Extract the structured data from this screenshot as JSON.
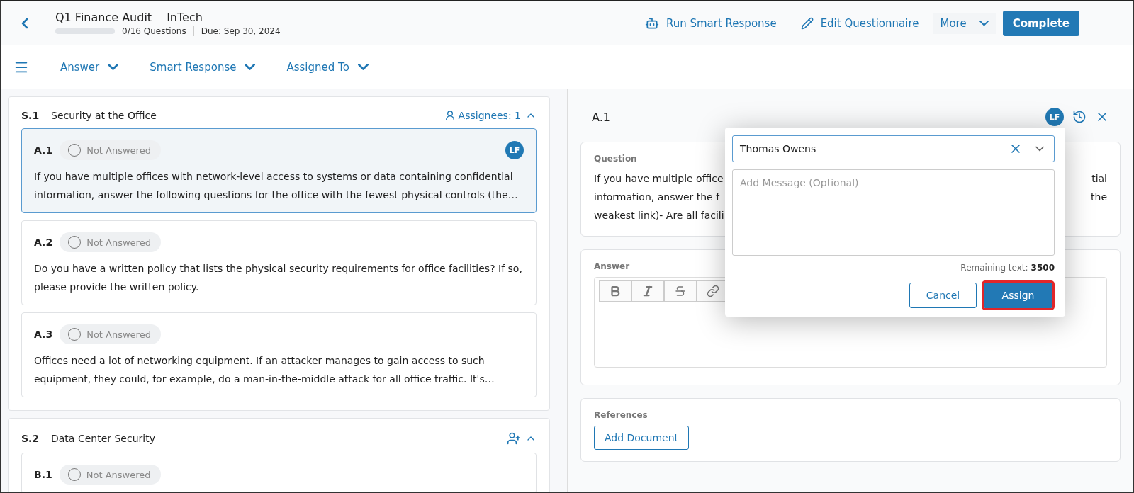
{
  "header": {
    "title": "Q1 Finance Audit",
    "company": "InTech",
    "progress": {
      "level": 0
    },
    "questions_count": "0/16 Questions",
    "due": "Due: Sep 30, 2024",
    "actions": [
      {
        "kind": "bot",
        "label": "Run Smart Response"
      },
      {
        "kind": "edit",
        "label": "Edit Questionnaire"
      },
      {
        "kind": "dropdown",
        "label": "More"
      },
      {
        "kind": "primary",
        "label": "Complete"
      }
    ]
  },
  "filters": [
    {
      "label": "Answer"
    },
    {
      "label": "Smart Response"
    },
    {
      "label": "Assigned To"
    }
  ],
  "sections": [
    {
      "number": "S.1",
      "title": "Security at the Office",
      "assignees": "Assignees: 1",
      "expanded": true,
      "questions": [
        {
          "number": "A.1",
          "status": "Not Answered",
          "selected": true,
          "assignee": "LF",
          "text": "If you have multiple offices with network-level access to systems or data containing confidential information, answer the following questions for the office with the fewest physical controls (the…"
        },
        {
          "number": "A.2",
          "status": "Not Answered",
          "selected": false,
          "text": "Do you have a written policy that lists the physical security requirements for office facilities? If so, please provide the written policy."
        },
        {
          "number": "A.3",
          "status": "Not Answered",
          "selected": false,
          "text": "Offices need a lot of networking equipment. If an attacker manages to gain access to such equipment, they could, for example, do a man-in-the-middle attack for all office traffic. It's…"
        }
      ]
    },
    {
      "number": "S.2",
      "title": "Data Center Security",
      "expanded": true,
      "questions": [
        {
          "number": "B.1",
          "status": "Not Answered",
          "selected": false
        }
      ]
    }
  ],
  "detail": {
    "number": "A.1",
    "assignee": "LF",
    "question_label": "Question",
    "question_lines": [
      {
        "start": "If you have multiple office",
        "end": "tial"
      },
      {
        "start": "information, answer the f",
        "end": "the"
      },
      {
        "start": "weakest link)- Are all facili"
      }
    ],
    "answer_label": "Answer",
    "toolbar": [
      {
        "kind": "bold"
      },
      {
        "kind": "italic"
      },
      {
        "kind": "strike"
      },
      {
        "kind": "link"
      }
    ],
    "references_label": "References",
    "add_document": "Add Document"
  },
  "assign_popup": {
    "assignee": "Thomas Owens",
    "message_placeholder": "Add Message (Optional)",
    "remaining_label": "Remaining text:",
    "remaining_value": "3500",
    "cancel": "Cancel",
    "assign": {
      "label": "Assign",
      "highlighted": true
    }
  }
}
